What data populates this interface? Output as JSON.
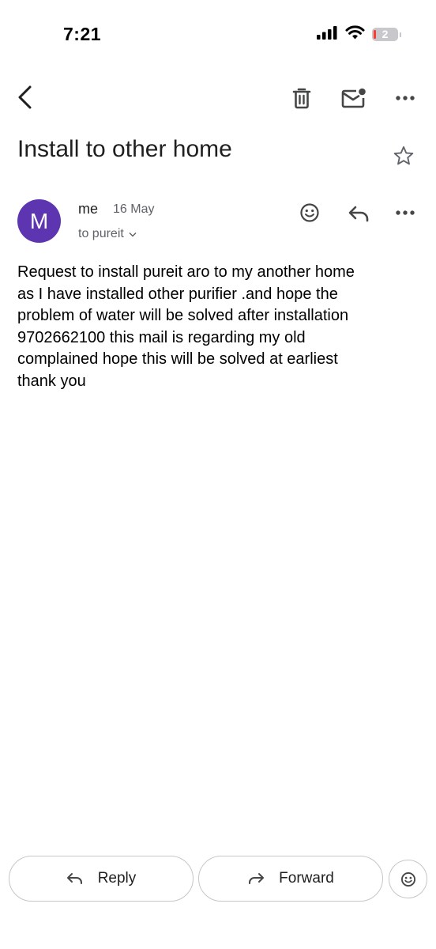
{
  "status_bar": {
    "time": "7:21",
    "battery_level": "2"
  },
  "toolbar": {
    "back_icon": "chevron-left-icon",
    "delete_icon": "trash-icon",
    "mark_unread_icon": "mail-unread-icon",
    "more_icon": "more-horizontal-icon"
  },
  "email": {
    "subject": "Install to other home",
    "avatar_letter": "M",
    "avatar_color": "#5e35b1",
    "sender": "me",
    "date": "16 May",
    "recipients": "to pureit",
    "body_lines": [
      "Request to install pureit aro to my another home",
      "as I have installed other purifier .and hope the",
      "problem of water will be solved after installation",
      "9702662100 this mail is regarding my old",
      "complained hope this will be solved at earliest",
      "thank you"
    ]
  },
  "actions": {
    "reply_label": "Reply",
    "forward_label": "Forward"
  }
}
